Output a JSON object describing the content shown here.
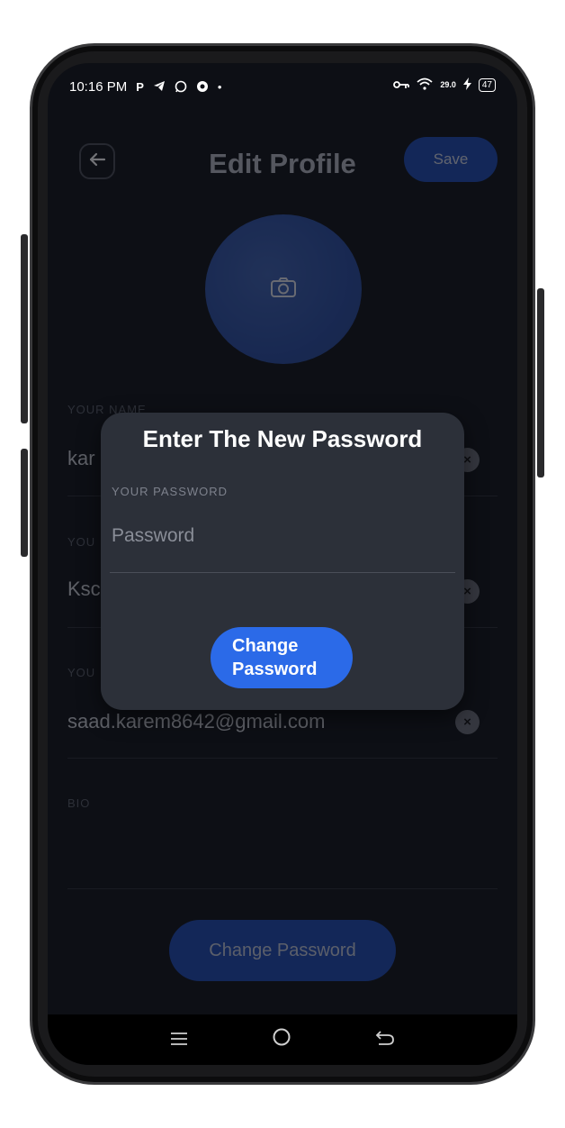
{
  "status_bar": {
    "time": "10:16 PM",
    "left_icons": [
      "P",
      "telegram-icon",
      "whatsapp-icon",
      "record-icon",
      "•"
    ],
    "network_text": "29.0",
    "battery": "47"
  },
  "header": {
    "title": "Edit Profile",
    "save_label": "Save"
  },
  "fields": [
    {
      "label": "YOUR NAME",
      "value": "kar"
    },
    {
      "label": "YOU",
      "value": "Ksc"
    },
    {
      "label": "YOU",
      "value": "saad.karem8642@gmail.com"
    },
    {
      "label": "BIO",
      "value": ""
    }
  ],
  "bottom_button": {
    "label": "Change Password"
  },
  "dialog": {
    "title": "Enter The New Password",
    "field_label": "YOUR PASSWORD",
    "placeholder": "Password",
    "button_line1": "Change",
    "button_line2": "Password"
  },
  "colors": {
    "accent": "#1d4bb6",
    "dialog_button": "#2b6ae8",
    "background": "#0d0f15",
    "dialog_bg": "#2c3039"
  }
}
